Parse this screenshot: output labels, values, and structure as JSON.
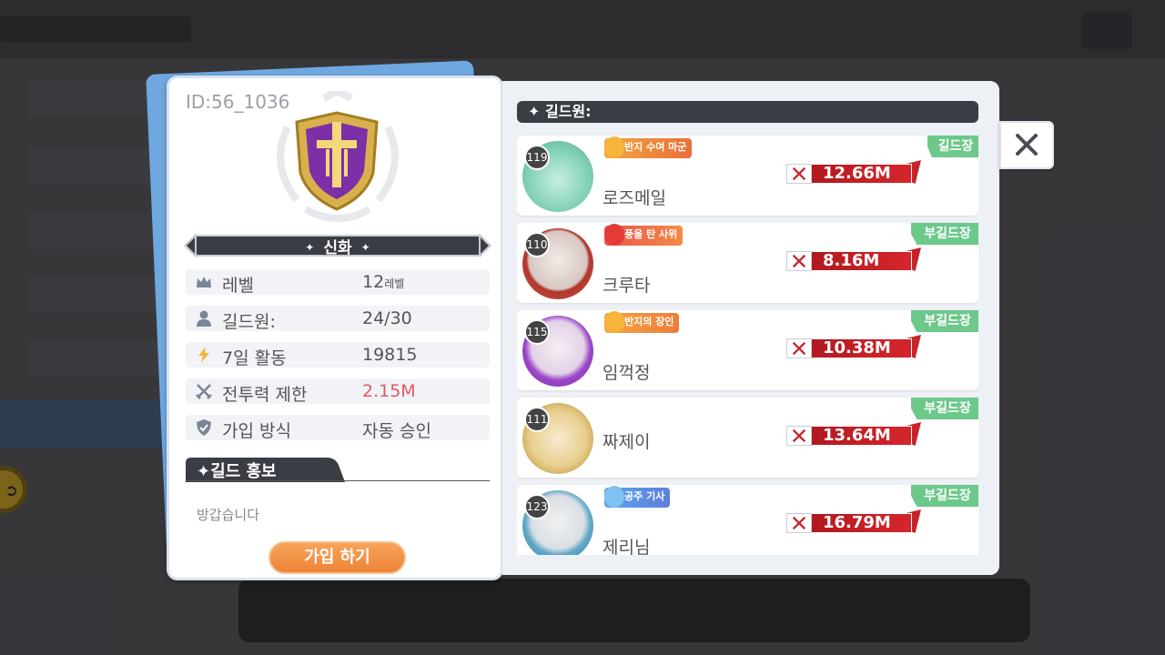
{
  "guild": {
    "id_text": "ID:56_1036",
    "rank_label": "신화",
    "stats": [
      {
        "icon": "crown-icon",
        "label": "레벨",
        "value": "12",
        "suffix": "레벨"
      },
      {
        "icon": "person-icon",
        "label": "길드원:",
        "value": "24/30"
      },
      {
        "icon": "lightning-icon",
        "label": "7일 활동",
        "value": "19815"
      },
      {
        "icon": "crossed-swords-icon",
        "label": "전투력 제한",
        "value": "2.15M"
      },
      {
        "icon": "shield-check-icon",
        "label": "가입 방식",
        "value": "자동 승인"
      }
    ],
    "promo_title": "길드 홍보",
    "promo_text": "방갑습니다",
    "join_label": "가입 하기"
  },
  "members_header": "길드원:",
  "members": [
    {
      "level": "119",
      "title": "반지 수여 마군",
      "name": "로즈메일",
      "power": "12.66M",
      "role": "길드장"
    },
    {
      "level": "110",
      "title": "풍을 탄 사위",
      "name": "크루타",
      "power": "8.16M",
      "role": "부길드장"
    },
    {
      "level": "115",
      "title": "반지의 장인",
      "name": "임꺽정",
      "power": "10.38M",
      "role": "부길드장"
    },
    {
      "level": "111",
      "title": "",
      "name": "짜제이",
      "power": "13.64M",
      "role": "부길드장"
    },
    {
      "level": "123",
      "title": "공주 기사",
      "name": "제리님",
      "power": "16.79M",
      "role": "부길드장"
    }
  ],
  "colors": {
    "accent_orange": "#ec8436",
    "power_red": "#c4242a",
    "role_green": "#6dc88b",
    "warning_red": "#e05a62"
  }
}
